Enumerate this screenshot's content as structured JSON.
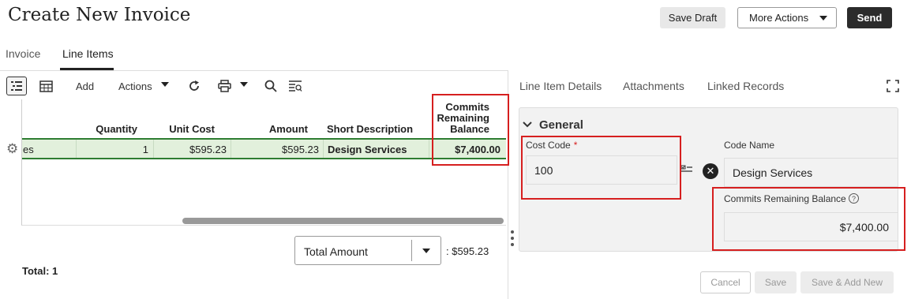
{
  "header": {
    "title": "Create New Invoice",
    "save_draft": "Save Draft",
    "more_actions": "More Actions",
    "send": "Send"
  },
  "tabs": [
    {
      "label": "Invoice",
      "active": false
    },
    {
      "label": "Line Items",
      "active": true
    }
  ],
  "toolbar": {
    "add": "Add",
    "actions": "Actions",
    "icons": [
      "list-view-icon",
      "table-view-icon",
      "refresh-icon",
      "print-icon",
      "search-icon",
      "filter-icon"
    ]
  },
  "grid": {
    "columns": {
      "quantity": "Quantity",
      "unit_cost": "Unit Cost",
      "amount": "Amount",
      "short_description": "Short Description",
      "commits_line1": "Commits",
      "commits_line2": "Remaining",
      "commits_line3": "Balance"
    },
    "rows": [
      {
        "partial": "es",
        "quantity": "1",
        "unit_cost": "$595.23",
        "amount": "$595.23",
        "short_description": "Design Services",
        "commits_remaining_balance": "$7,400.00"
      }
    ]
  },
  "footer": {
    "total_select": "Total Amount",
    "total_value": ": $595.23",
    "total_count": "Total: 1"
  },
  "detail": {
    "tabs": [
      "Line Item Details",
      "Attachments",
      "Linked Records"
    ],
    "section": "General",
    "cost_code_label": "Cost Code",
    "cost_code_required": "*",
    "cost_code_value": "100",
    "code_name_label": "Code Name",
    "code_name_value": "Design Services",
    "commits_label": "Commits Remaining Balance",
    "commits_value": "$7,400.00",
    "buttons": {
      "cancel": "Cancel",
      "save": "Save",
      "save_add_new": "Save & Add New"
    }
  },
  "colors": {
    "highlight": "#d61f1f",
    "selected_row": "#e2f0dc",
    "selected_row_border": "#2e7d32",
    "primary_button": "#2b2b2b"
  }
}
